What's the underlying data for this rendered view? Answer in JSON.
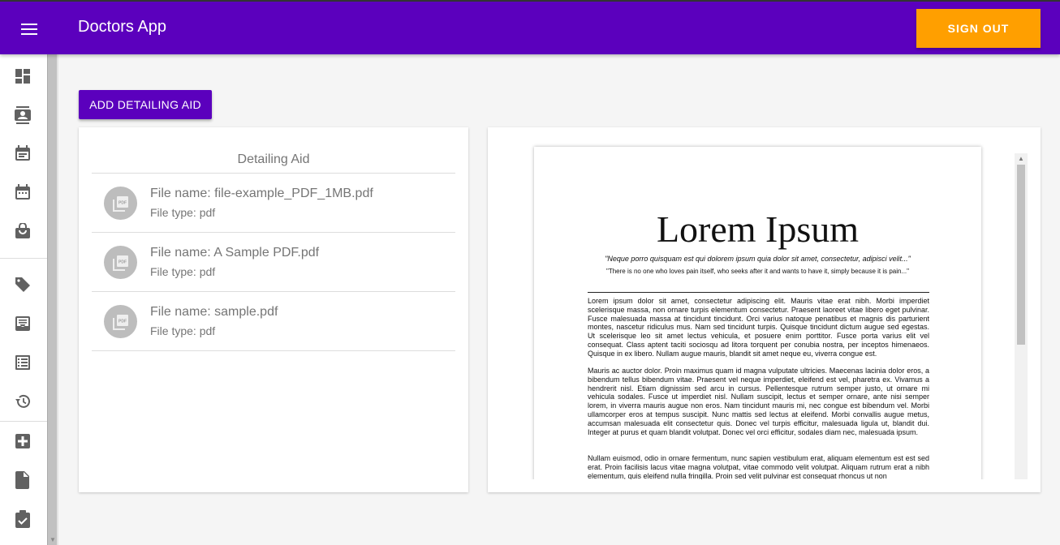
{
  "appbar": {
    "title": "Doctors App",
    "signout_label": "SIGN OUT",
    "menu_icon": "menu-icon"
  },
  "sidebar": {
    "items": [
      {
        "name": "dashboard",
        "icon": "dashboard-icon"
      },
      {
        "name": "contacts",
        "icon": "contact-card-icon"
      },
      {
        "name": "events",
        "icon": "event-note-icon"
      },
      {
        "name": "calendar",
        "icon": "calendar-icon"
      },
      {
        "name": "shop",
        "icon": "shopping-bag-icon"
      },
      {
        "name": "tags",
        "icon": "tag-icon"
      },
      {
        "name": "inbox",
        "icon": "inbox-icon"
      },
      {
        "name": "list",
        "icon": "list-icon"
      },
      {
        "name": "history",
        "icon": "history-icon"
      },
      {
        "name": "add",
        "icon": "add-box-icon"
      },
      {
        "name": "document",
        "icon": "document-icon"
      },
      {
        "name": "assignment",
        "icon": "clipboard-check-icon"
      }
    ]
  },
  "main": {
    "add_button_label": "ADD DETAILING AID",
    "list_title": "Detailing Aid",
    "files": [
      {
        "name": "File name: file-example_PDF_1MB.pdf",
        "type": "File type: pdf"
      },
      {
        "name": "File name: A Sample PDF.pdf",
        "type": "File type: pdf"
      },
      {
        "name": "File name: sample.pdf",
        "type": "File type: pdf"
      }
    ]
  },
  "viewer": {
    "heading": "Lorem Ipsum",
    "quote1": "\"Neque porro quisquam est qui dolorem ipsum quia dolor sit amet, consectetur, adipisci velit...\"",
    "quote2": "\"There is no one who loves pain itself, who seeks after it and wants to have it, simply because it is pain...\"",
    "paragraphs": [
      "Lorem ipsum dolor sit amet, consectetur adipiscing elit. Mauris vitae erat nibh. Morbi imperdiet scelerisque massa, non ornare turpis elementum consectetur. Praesent laoreet vitae libero eget pulvinar. Fusce malesuada massa at tincidunt tincidunt. Orci varius natoque penatibus et magnis dis parturient montes, nascetur ridiculus mus. Nam sed tincidunt turpis. Quisque tincidunt dictum augue sed egestas. Ut scelerisque leo sit amet lectus vehicula, et posuere enim porttitor. Fusce porta varius elit vel consequat. Class aptent taciti sociosqu ad litora torquent per conubia nostra, per inceptos himenaeos. Quisque in ex libero. Nullam augue mauris, blandit sit amet neque eu, viverra congue est.",
      "Mauris ac auctor dolor. Proin maximus quam id magna vulputate ultricies. Maecenas lacinia dolor eros, a bibendum tellus bibendum vitae. Praesent vel neque imperdiet, eleifend est vel, pharetra ex. Vivamus a hendrerit nisl. Etiam dignissim sed arcu in cursus. Pellentesque rutrum semper justo, ut ornare mi vehicula sodales. Fusce ut imperdiet nisl. Nullam suscipit, lectus et semper ornare, ante nisi semper lorem, in viverra mauris augue non eros. Nam tincidunt mauris mi, nec congue est bibendum vel. Morbi ullamcorper eros at tempus suscipit. Nunc mattis sed lectus at eleifend. Morbi convallis augue metus, accumsan malesuada elit consectetur quis. Donec vel turpis efficitur, malesuada ligula ut, blandit dui. Integer at purus et quam blandit volutpat. Donec vel orci efficitur, sodales diam nec, malesuada ipsum.",
      "Nullam euismod, odio in ornare fermentum, nunc sapien vestibulum erat, aliquam elementum est est sed erat. Proin facilisis lacus vitae magna volutpat, vitae commodo velit volutpat. Aliquam rutrum erat a nibh elementum, quis eleifend nulla fringilla. Proin sed velit pulvinar est consequat rhoncus ut non"
    ]
  },
  "colors": {
    "primary": "#5b00bd",
    "accent": "#ff9f00",
    "icon": "#616161"
  }
}
